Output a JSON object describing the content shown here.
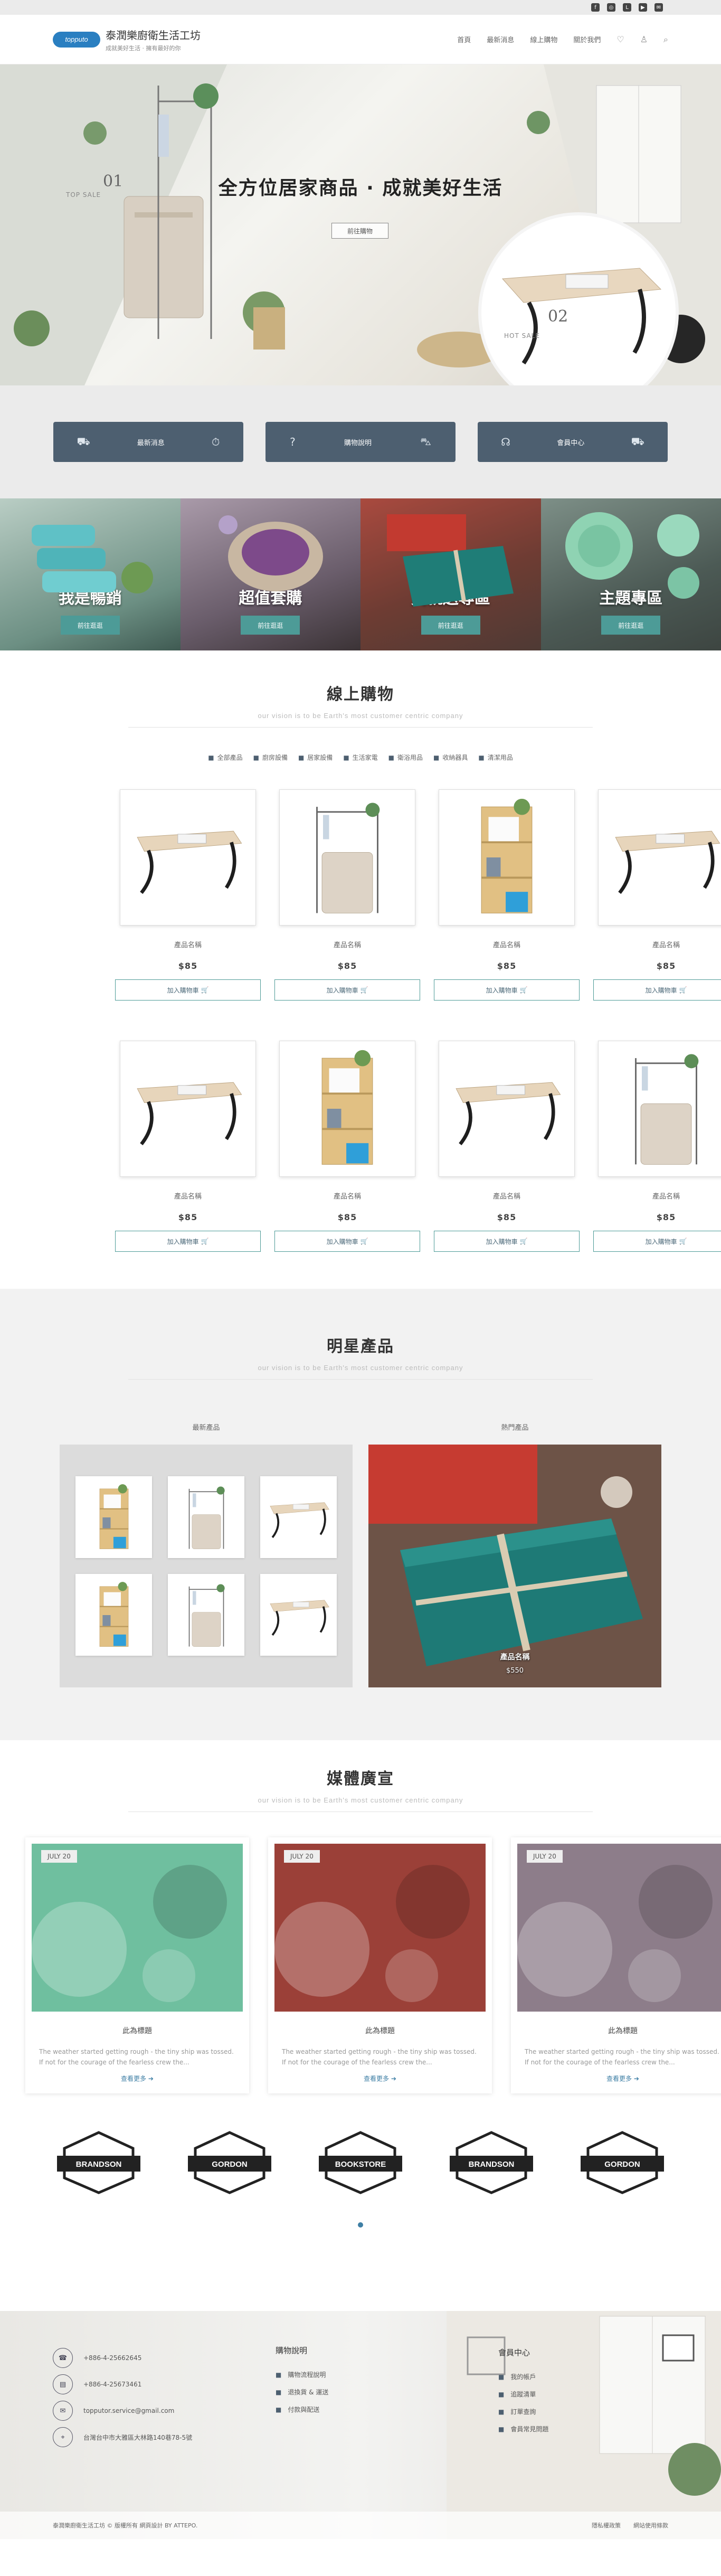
{
  "topbar": {
    "icons": [
      "facebook-icon",
      "instagram-icon",
      "line-icon",
      "youtube-icon",
      "share-icon"
    ]
  },
  "header": {
    "logo_badge": "topputo",
    "brand_name": "泰潤樂廚衛生活工坊",
    "brand_tagline": "成就美好生活 · 擁有最好的你",
    "nav": [
      "首頁",
      "最新消息",
      "線上購物",
      "關於我們"
    ]
  },
  "hero": {
    "title": "全方位居家商品 · 成就美好生活",
    "button": "前往購物",
    "left_num": "01",
    "left_label": "TOP SALE",
    "right_num": "02",
    "right_label": "HOT SALE"
  },
  "features": [
    {
      "label": "最新消息"
    },
    {
      "label": "購物說明"
    },
    {
      "label": "會員中心"
    }
  ],
  "categories": [
    {
      "title": "我是暢銷",
      "button": "前往逛逛",
      "bg": "#9fb7ad"
    },
    {
      "title": "超值套購",
      "button": "前往逛逛",
      "bg": "#7d6a7f"
    },
    {
      "title": "買就送專區",
      "button": "前往逛逛",
      "bg": "#8b3a32"
    },
    {
      "title": "主題專區",
      "button": "前往逛逛",
      "bg": "#6a8c80"
    }
  ],
  "shop": {
    "title": "線上購物",
    "subtitle": "our vision is to be Earth's most customer centric company",
    "filters": [
      "全部產品",
      "廚房設備",
      "居家設備",
      "生活家電",
      "衛浴用品",
      "收納器具",
      "清潔用品"
    ],
    "products": [
      {
        "name": "產品名稱",
        "price": "$85",
        "button": "加入購物車",
        "kind": "table"
      },
      {
        "name": "產品名稱",
        "price": "$85",
        "button": "加入購物車",
        "kind": "washer"
      },
      {
        "name": "產品名稱",
        "price": "$85",
        "button": "加入購物車",
        "kind": "shelf"
      },
      {
        "name": "產品名稱",
        "price": "$85",
        "button": "加入購物車",
        "kind": "table"
      },
      {
        "name": "產品名稱",
        "price": "$85",
        "button": "加入購物車",
        "kind": "table"
      },
      {
        "name": "產品名稱",
        "price": "$85",
        "button": "加入購物車",
        "kind": "shelf"
      },
      {
        "name": "產品名稱",
        "price": "$85",
        "button": "加入購物車",
        "kind": "table"
      },
      {
        "name": "產品名稱",
        "price": "$85",
        "button": "加入購物車",
        "kind": "washer"
      }
    ]
  },
  "star": {
    "title": "明星產品",
    "subtitle": "our vision is to be Earth's most customer centric company",
    "new_label": "最新產品",
    "hot_label": "熱門產品",
    "thumbs": [
      "shelf",
      "washer",
      "table",
      "shelf",
      "washer",
      "table"
    ],
    "hot_name": "產品名稱",
    "hot_price": "$550"
  },
  "media": {
    "title": "媒體廣宣",
    "subtitle": "our vision is to be Earth's most customer centric company",
    "cards": [
      {
        "date": "JULY 20",
        "title": "此為標題",
        "text": "The weather started getting rough - the tiny ship was tossed. If not for the courage of the fearless crew the...",
        "more": "查看更多",
        "bg": "#6fbf9f"
      },
      {
        "date": "JULY 20",
        "title": "此為標題",
        "text": "The weather started getting rough - the tiny ship was tossed. If not for the courage of the fearless crew the...",
        "more": "查看更多",
        "bg": "#9b4038"
      },
      {
        "date": "JULY 20",
        "title": "此為標題",
        "text": "The weather started getting rough - the tiny ship was tossed. If not for the courage of the fearless crew the...",
        "more": "查看更多",
        "bg": "#8d7d8a"
      }
    ]
  },
  "brands": [
    "BRANDSON",
    "GORDON",
    "BOOKSTORE",
    "BRANDSON",
    "GORDON"
  ],
  "footer": {
    "contacts": [
      {
        "icon": "phone-icon",
        "text": "+886-4-25662645"
      },
      {
        "icon": "fax-icon",
        "text": "+886-4-25673461"
      },
      {
        "icon": "mail-icon",
        "text": "topputor.service@gmail.com"
      },
      {
        "icon": "map-pin-icon",
        "text": "台灣台中市大雅區大林路140巷78-5號"
      }
    ],
    "guide_title": "購物說明",
    "guide_links": [
      "購物流程說明",
      "退換貨 & 運送",
      "付款與配送"
    ],
    "member_title": "會員中心",
    "member_links": [
      "我的帳戶",
      "追蹤清單",
      "訂單查詢",
      "會員常見問題"
    ],
    "copyright": "泰潤樂廚衛生活工坊 © 版權所有 網頁設計 BY ATTEPO.",
    "bottom_links": [
      "隱私權政策",
      "網站使用條款"
    ]
  }
}
